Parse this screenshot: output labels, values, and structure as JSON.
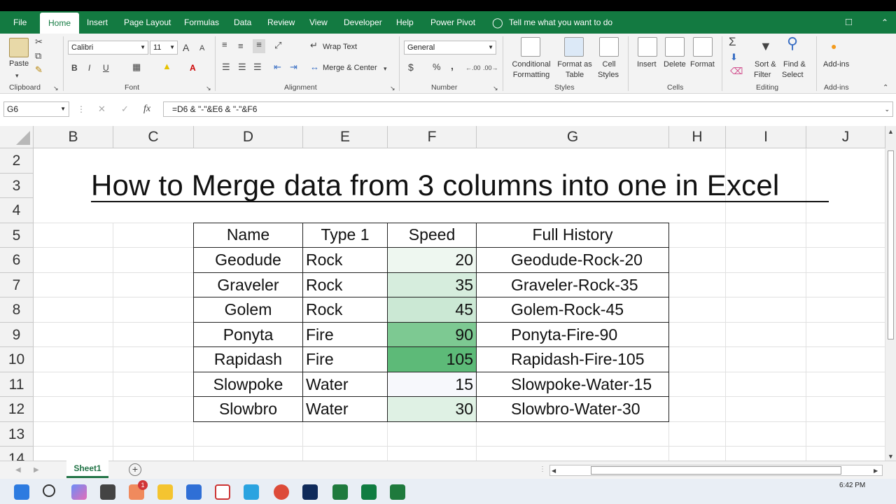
{
  "menu": {
    "tabs": [
      "File",
      "Home",
      "Insert",
      "Page Layout",
      "Formulas",
      "Data",
      "Review",
      "View",
      "Developer",
      "Help",
      "Power Pivot"
    ],
    "tell_me": "Tell me what you want to do"
  },
  "ribbon": {
    "clipboard": {
      "paste": "Paste",
      "group": "Clipboard"
    },
    "font": {
      "name": "Calibri",
      "size": "11",
      "grow": "A",
      "shrink": "A",
      "bold": "B",
      "italic": "I",
      "underline": "U",
      "font_color": "A",
      "group": "Font"
    },
    "alignment": {
      "wrap": "Wrap Text",
      "merge": "Merge & Center",
      "group": "Alignment"
    },
    "number": {
      "format": "General",
      "currency": "$",
      "percent": "%",
      "comma": ",",
      "group": "Number"
    },
    "styles": {
      "conditional": [
        "Conditional",
        "Formatting"
      ],
      "format_table": [
        "Format as",
        "Table"
      ],
      "cell_styles": [
        "Cell",
        "Styles"
      ],
      "group": "Styles"
    },
    "cells": {
      "insert": "Insert",
      "delete": "Delete",
      "format": "Format",
      "group": "Cells"
    },
    "editing": {
      "autosum": "Σ",
      "sort": [
        "Sort &",
        "Filter"
      ],
      "find": [
        "Find &",
        "Select"
      ],
      "group": "Editing"
    },
    "addins": {
      "label": "Add-ins",
      "group": "Add-ins"
    }
  },
  "formula_bar": {
    "name_box": "G6",
    "fx": "fx",
    "formula": "=D6 & \"-\"&E6 & \"-\"&F6"
  },
  "grid": {
    "columns": [
      "B",
      "C",
      "D",
      "E",
      "F",
      "G",
      "H",
      "I",
      "J"
    ],
    "rows": [
      "2",
      "3",
      "4",
      "5",
      "6",
      "7",
      "8",
      "9",
      "10",
      "11",
      "12",
      "13",
      "14"
    ],
    "title": "How to Merge data from 3 columns into one in Excel",
    "headers": {
      "name": "Name",
      "type": "Type 1",
      "speed": "Speed",
      "full": "Full History"
    },
    "data": [
      {
        "name": "Geodude",
        "type": "Rock",
        "speed": "20",
        "full": "Geodude-Rock-20"
      },
      {
        "name": "Graveler",
        "type": "Rock",
        "speed": "35",
        "full": "Graveler-Rock-35"
      },
      {
        "name": "Golem",
        "type": "Rock",
        "speed": "45",
        "full": "Golem-Rock-45"
      },
      {
        "name": "Ponyta",
        "type": "Fire",
        "speed": "90",
        "full": "Ponyta-Fire-90"
      },
      {
        "name": "Rapidash",
        "type": "Fire",
        "speed": "105",
        "full": "Rapidash-Fire-105"
      },
      {
        "name": "Slowpoke",
        "type": "Water",
        "speed": "15",
        "full": "Slowpoke-Water-15"
      },
      {
        "name": "Slowbro",
        "type": "Water",
        "speed": "30",
        "full": "Slowbro-Water-30"
      }
    ],
    "speed_fills": [
      "#eef7f0",
      "#d6eddd",
      "#cbe8d4",
      "#7dc992",
      "#5dba78",
      "#f7f8fc",
      "#dff1e4"
    ]
  },
  "sheet_tabs": {
    "active": "Sheet1",
    "add": "+"
  },
  "taskbar": {
    "time": "6:42 PM",
    "badge": "1"
  },
  "colors": {
    "excel_green": "#137a41",
    "accent": "#217346"
  }
}
